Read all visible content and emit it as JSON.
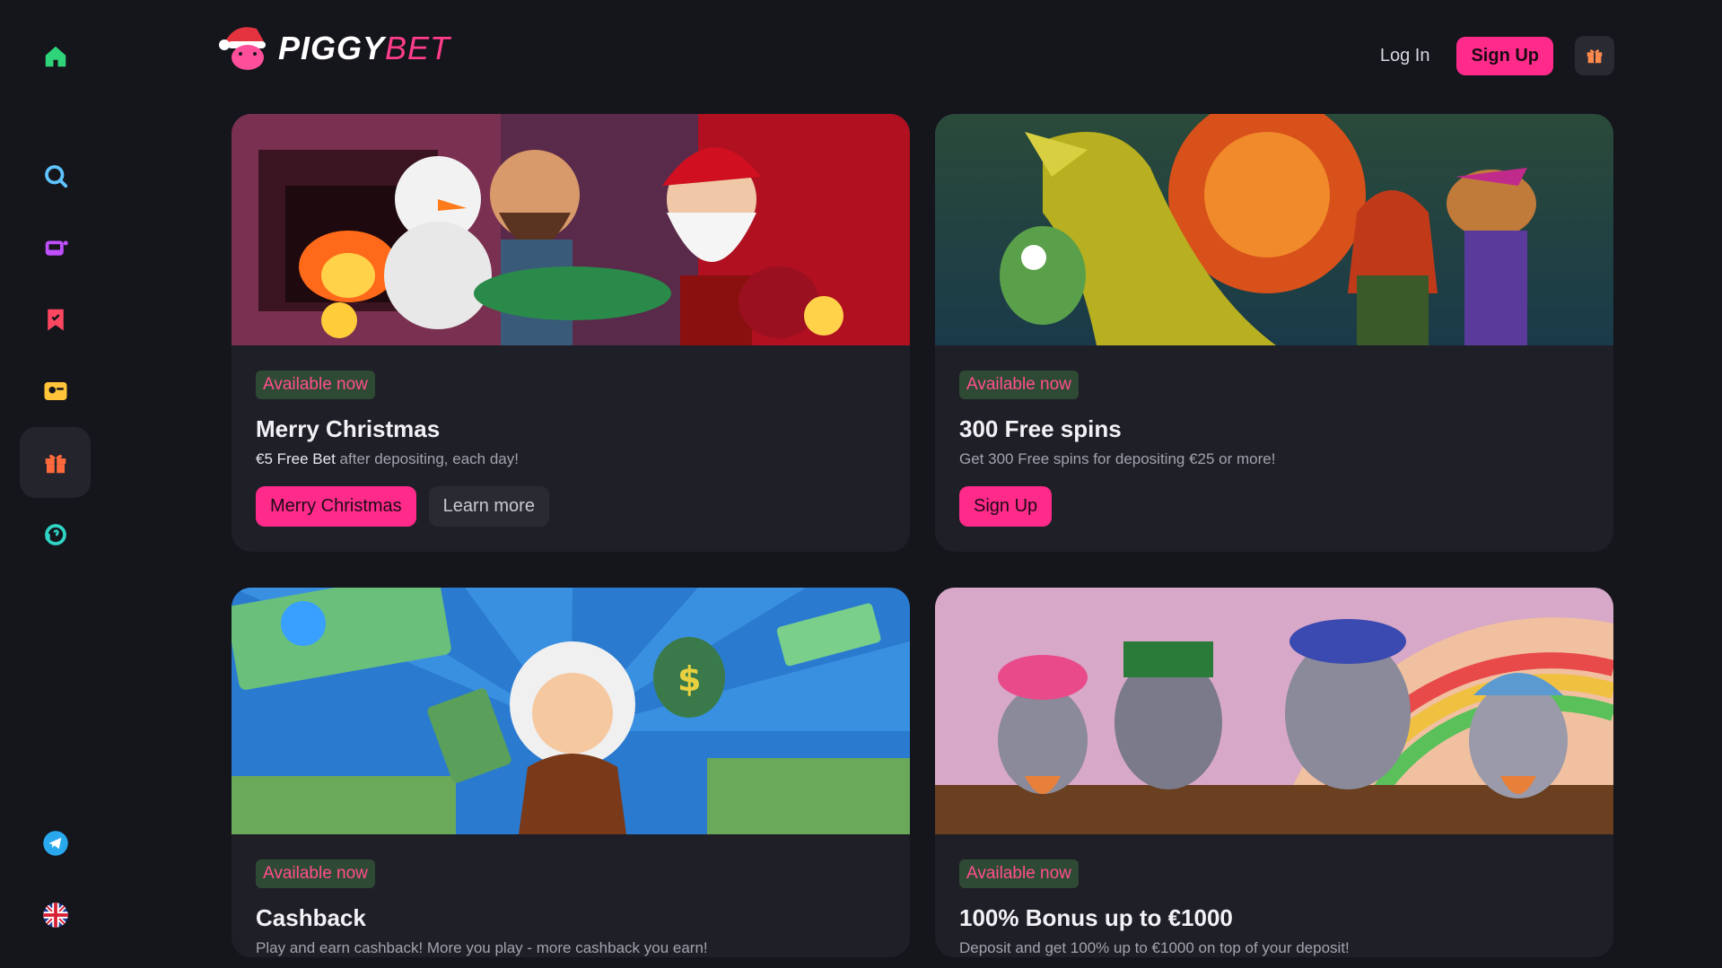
{
  "brand": {
    "name_part1": "PIGGY",
    "name_part2": "BET"
  },
  "header": {
    "login_label": "Log In",
    "signup_label": "Sign Up",
    "gift_icon": "gift-icon"
  },
  "sidebar": {
    "items": [
      {
        "icon": "home-icon",
        "color": "#2fd47a"
      },
      {
        "icon": "search-icon",
        "color": "#5ec3ff"
      },
      {
        "icon": "slot-machine-icon",
        "color": "#c04fff"
      },
      {
        "icon": "bookmark-icon",
        "color": "#ff4761"
      },
      {
        "icon": "profile-card-icon",
        "color": "#ffc43a"
      },
      {
        "icon": "gift-icon",
        "color": "#ff6a3d",
        "active": true
      },
      {
        "icon": "support-icon",
        "color": "#2fd4c4"
      },
      {
        "icon": "telegram-icon",
        "color": "#2aa8ee"
      },
      {
        "icon": "uk-flag-icon",
        "color": "#ffffff"
      }
    ]
  },
  "promos": [
    {
      "badge": "Available now",
      "title": "Merry Christmas",
      "desc_bold": "€5 Free Bet",
      "desc_rest": " after depositing, each day!",
      "primary": "Merry Christmas",
      "secondary": "Learn more"
    },
    {
      "badge": "Available now",
      "title": "300 Free spins",
      "desc_bold": "",
      "desc_rest": "Get 300 Free spins for depositing €25 or more!",
      "primary": "Sign Up"
    },
    {
      "badge": "Available now",
      "title": "Cashback",
      "desc_bold": "",
      "desc_rest": "Play and earn cashback! More you play - more cashback you earn!"
    },
    {
      "badge": "Available now",
      "title": "100% Bonus up to €1000",
      "desc_bold": "",
      "desc_rest": "Deposit and get 100% up to €1000 on top of your deposit!"
    }
  ],
  "colors": {
    "accent": "#ff2a8a",
    "background": "#15151c",
    "card": "#1f1f27",
    "badge_bg": "#2f4a34"
  }
}
